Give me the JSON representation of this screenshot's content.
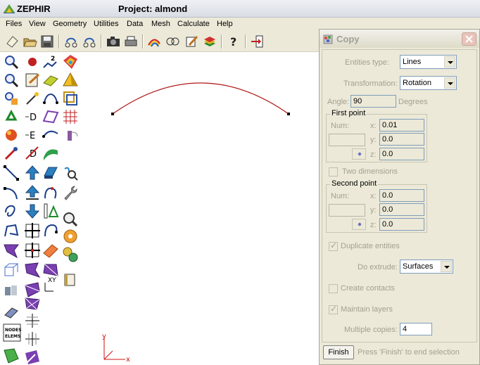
{
  "window": {
    "app_name": "ZEPHIR",
    "project_title": "Project: almond"
  },
  "menu": [
    "Files",
    "View",
    "Geometry",
    "Utilities",
    "Data",
    "Mesh",
    "Calculate",
    "Help"
  ],
  "palette": {
    "nodes_elems_label": "NODES\nELEMS",
    "xy_label": "XY"
  },
  "canvas": {
    "axis_x": "x",
    "axis_y": "y"
  },
  "dialog": {
    "title": "Copy",
    "entities_type_label": "Entities type:",
    "entities_type_value": "Lines",
    "transformation_label": "Transformation:",
    "transformation_value": "Rotation",
    "angle_label": "Angle:",
    "angle_value": "90",
    "angle_unit": "Degrees",
    "first_point": {
      "title": "First point",
      "num_label": "Num:",
      "x_label": "x:",
      "x_value": "0.01",
      "y_label": "y:",
      "y_value": "0.0",
      "z_label": "z:",
      "z_value": "0.0"
    },
    "two_dimensions_label": "Two dimensions",
    "two_dimensions_checked": false,
    "second_point": {
      "title": "Second point",
      "num_label": "Num:",
      "x_label": "x:",
      "x_value": "0.0",
      "y_label": "y:",
      "y_value": "0.0",
      "z_label": "z:",
      "z_value": "0.0"
    },
    "duplicate_entities_label": "Duplicate entities",
    "duplicate_entities_checked": true,
    "do_extrude_label": "Do extrude:",
    "do_extrude_value": "Surfaces",
    "create_contacts_label": "Create contacts",
    "create_contacts_checked": false,
    "maintain_layers_label": "Maintain layers",
    "maintain_layers_checked": true,
    "multiple_copies_label": "Multiple copies:",
    "multiple_copies_value": "4",
    "finish_button": "Finish",
    "status": "Press 'Finish' to end selection"
  },
  "colors": {
    "curve": "#b01818",
    "axis": "#d01010",
    "menu_bg": "#ece9d8"
  }
}
